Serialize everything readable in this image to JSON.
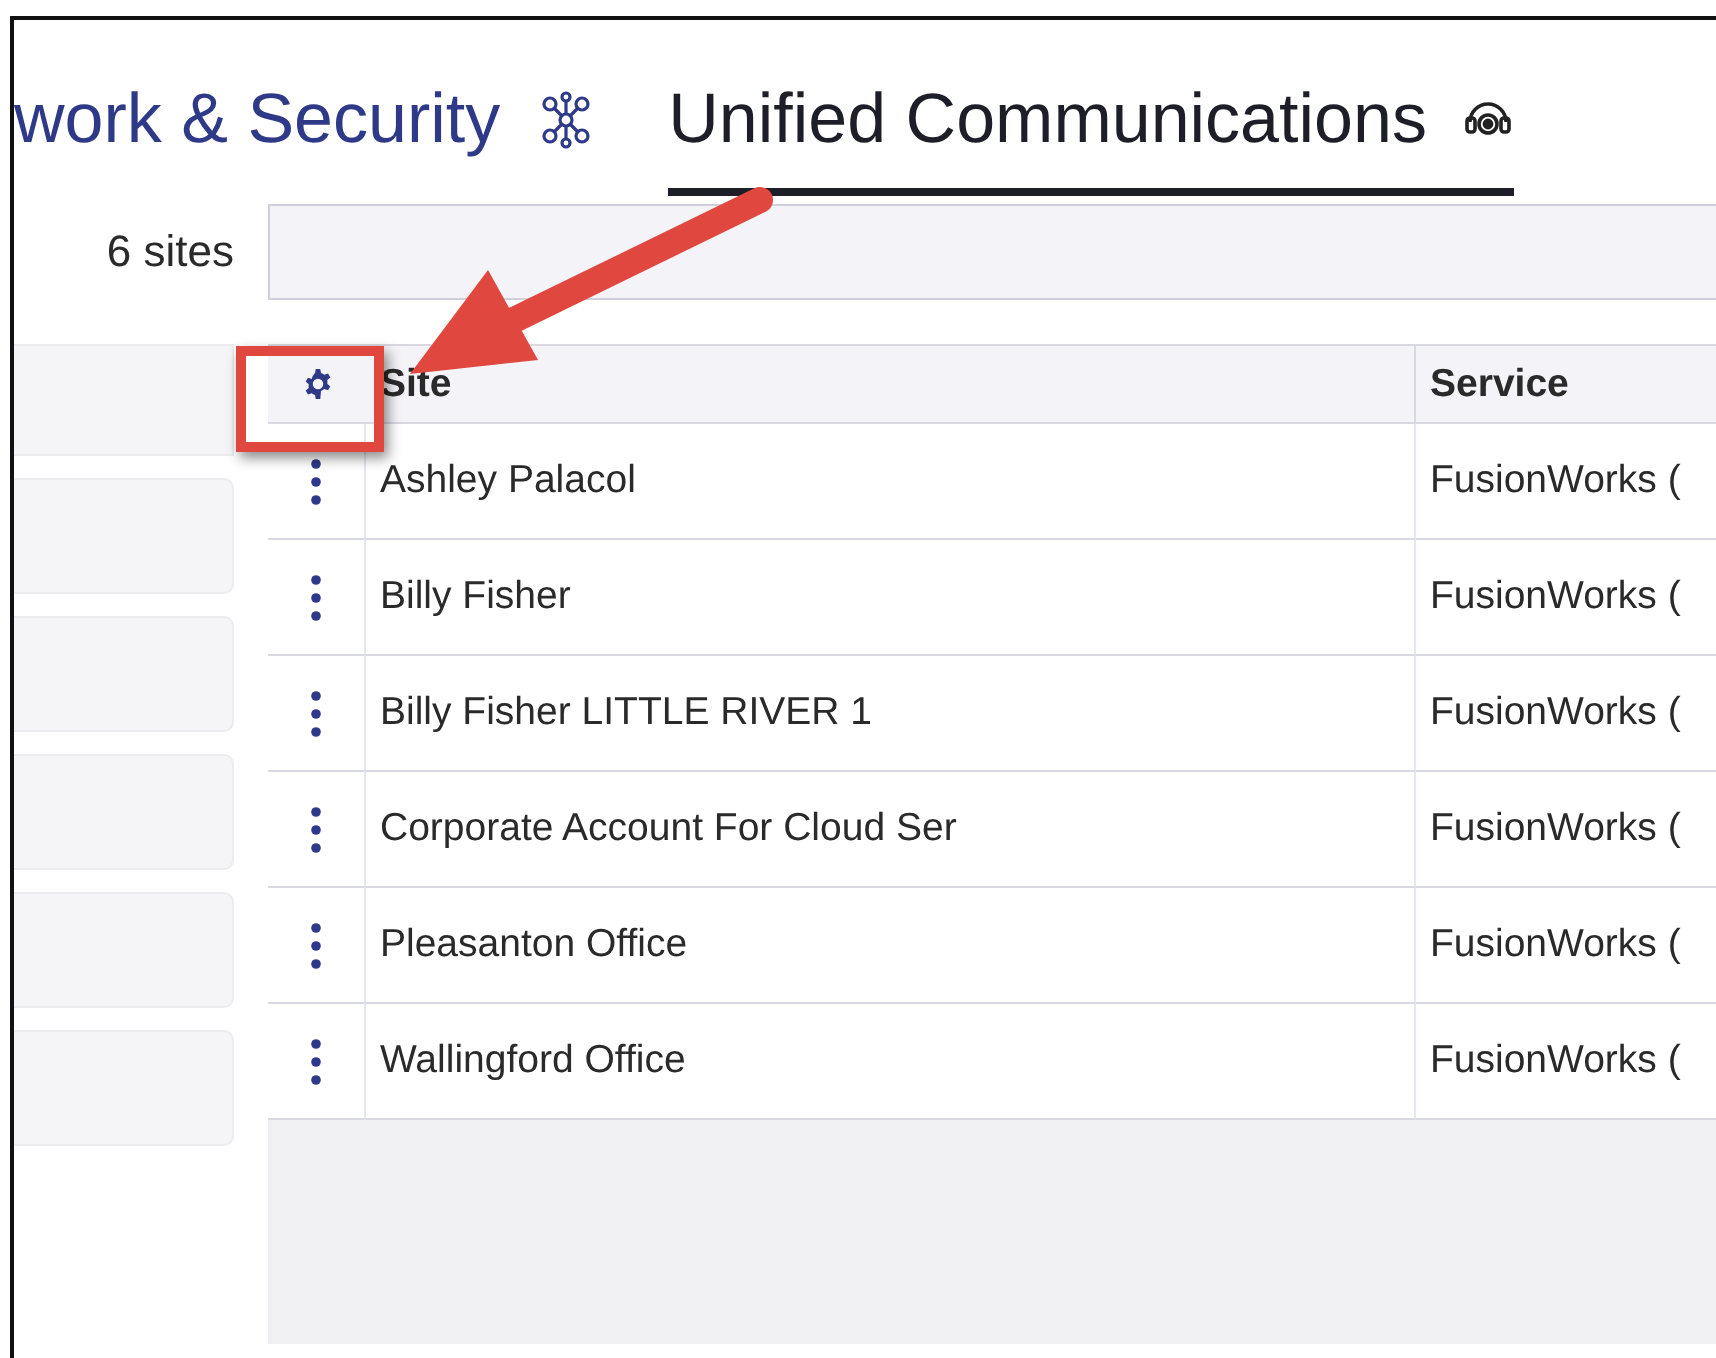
{
  "tabs": [
    {
      "label": "work & Security",
      "selected": false
    },
    {
      "label": "Unified Communications",
      "selected": true
    }
  ],
  "site_count": "6 sites",
  "table": {
    "columns": [
      "Site",
      "Service"
    ],
    "rows": [
      {
        "site": "Ashley Palacol",
        "service": "FusionWorks ("
      },
      {
        "site": "Billy Fisher",
        "service": "FusionWorks ("
      },
      {
        "site": "Billy Fisher LITTLE RIVER 1",
        "service": "FusionWorks ("
      },
      {
        "site": "Corporate Account For Cloud Ser",
        "service": "FusionWorks ("
      },
      {
        "site": "Pleasanton Office",
        "service": "FusionWorks ("
      },
      {
        "site": "Wallingford Office",
        "service": "FusionWorks ("
      }
    ]
  }
}
